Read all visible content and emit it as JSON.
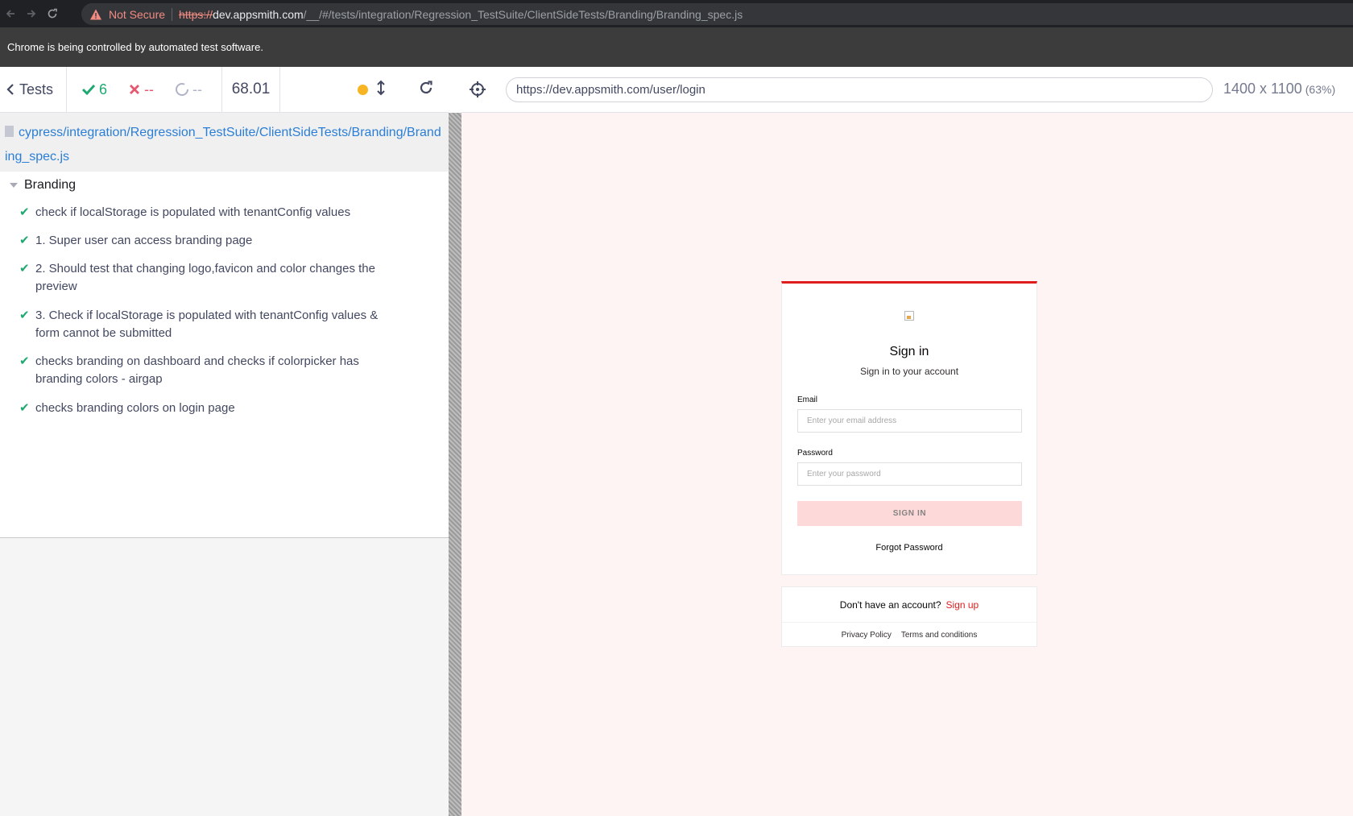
{
  "browser": {
    "security_label": "Not Secure",
    "url_scheme": "https://",
    "url_host": "dev.appsmith.com",
    "url_path": "/__/#/tests/integration/Regression_TestSuite/ClientSideTests/Branding/Branding_spec.js",
    "infobar_text": "Chrome is being controlled by automated test software."
  },
  "reporter": {
    "tests_label": "Tests",
    "passed": "6",
    "failed": "--",
    "pending": "--",
    "duration": "68.01",
    "spec_path": "cypress/integration/Regression_TestSuite/ClientSideTests/Branding/Branding_spec.js",
    "suite_title": "Branding",
    "tests": [
      "check if localStorage is populated with tenantConfig values",
      "1. Super user can access branding page",
      "2. Should test that changing logo,favicon and color changes the preview",
      "3. Check if localStorage is populated with tenantConfig values & form cannot be submitted",
      "checks branding on dashboard and checks if colorpicker has branding colors - airgap",
      "checks branding colors on login page"
    ]
  },
  "aut": {
    "url": "https://dev.appsmith.com/user/login",
    "viewport": "1400 x 1100",
    "scale": "(63%)"
  },
  "login": {
    "title": "Sign in",
    "subtitle": "Sign in to your account",
    "email_label": "Email",
    "email_placeholder": "Enter your email address",
    "password_label": "Password",
    "password_placeholder": "Enter your password",
    "signin_button": "SIGN IN",
    "forgot_password": "Forgot Password",
    "no_account_text": "Don't have an account?",
    "signup_link": "Sign up",
    "privacy_policy": "Privacy Policy",
    "terms": "Terms and conditions"
  },
  "colors": {
    "brand_primary": "#e01d1d",
    "pass_green": "#1fa971",
    "fail_red": "#e45770",
    "running_orange": "#f8b523"
  }
}
